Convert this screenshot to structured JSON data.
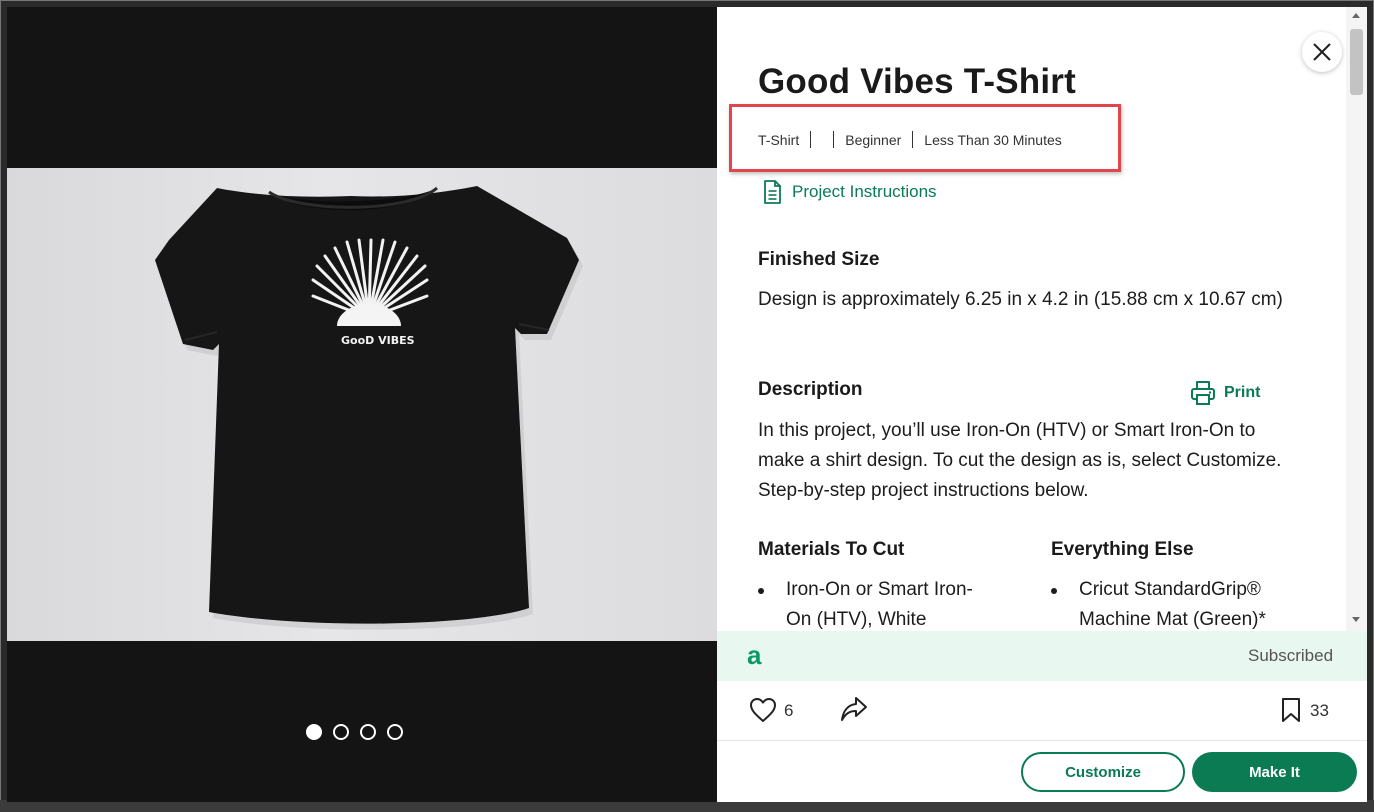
{
  "project": {
    "title": "Good Vibes T-Shirt",
    "meta": {
      "category": "T-Shirt",
      "empty_field": "",
      "skill_level": "Beginner",
      "duration": "Less Than 30 Minutes"
    },
    "instructions_link": "Project Instructions",
    "finished_size": {
      "heading": "Finished Size",
      "text": "Design is approximately 6.25 in x 4.2 in (15.88 cm x 10.67 cm)"
    },
    "description": {
      "heading": "Description",
      "print_label": "Print",
      "text": "In this project, you’ll use Iron-On (HTV) or Smart Iron-On to make a shirt design. To cut the design as is, select Customize. Step-by-step project instructions below."
    },
    "materials_to_cut": {
      "heading": "Materials To Cut",
      "items": [
        "Iron-On or Smart Iron-On (HTV), White"
      ]
    },
    "everything_else": {
      "heading": "Everything Else",
      "items": [
        "Cricut StandardGrip® Machine Mat (Green)*"
      ]
    }
  },
  "subscription": {
    "logo": "a",
    "status": "Subscribed"
  },
  "social": {
    "likes": "6",
    "saves": "33"
  },
  "buttons": {
    "customize": "Customize",
    "make_it": "Make It"
  },
  "gallery": {
    "slide_count": 4,
    "active_slide": 1,
    "shirt_print": "GooD VIBES"
  },
  "colors": {
    "brand_green": "#0b7b53",
    "highlight_red": "#e0474c",
    "subscription_bg": "#e8f7f0"
  }
}
